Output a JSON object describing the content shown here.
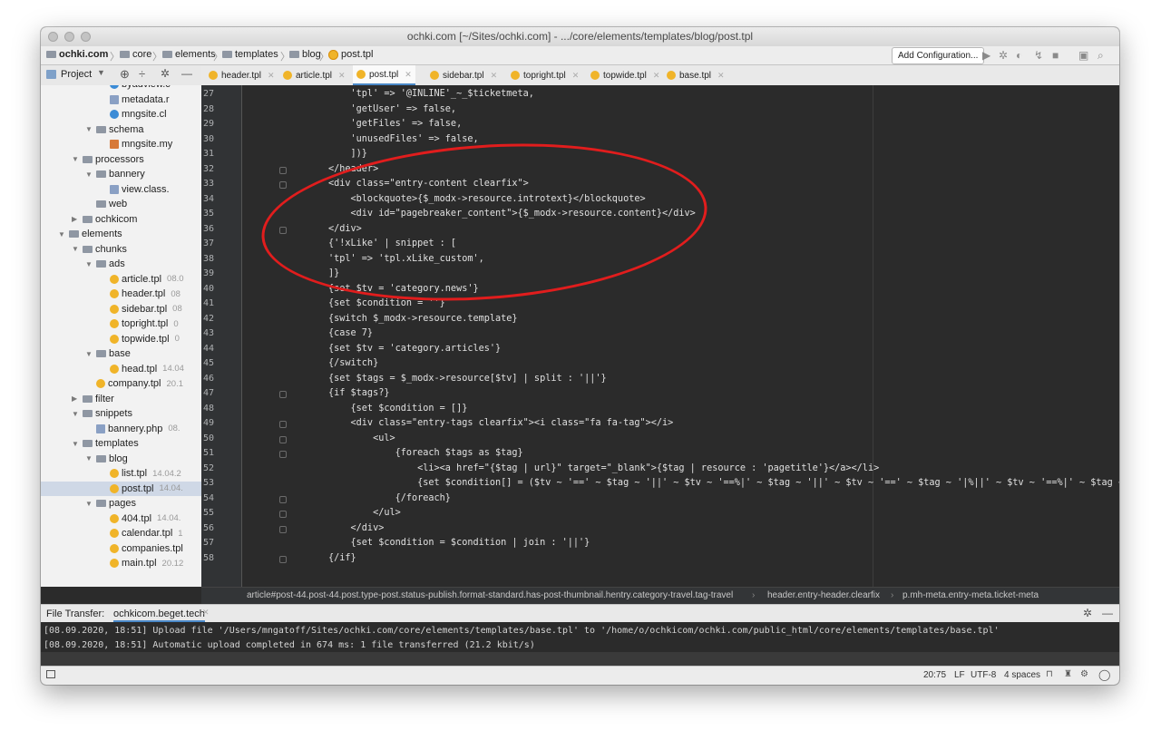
{
  "window": {
    "title": "ochki.com [~/Sites/ochki.com] - .../core/elements/templates/blog/post.tpl"
  },
  "navbar": {
    "crumbs": [
      "ochki.com",
      "core",
      "elements",
      "templates",
      "blog",
      "post.tpl"
    ],
    "add_configuration": "Add Configuration..."
  },
  "sidebar": {
    "title": "Project",
    "rows": [
      {
        "label": "byadview.c",
        "icon": "class-icon",
        "meta": ""
      },
      {
        "label": "metadata.r",
        "icon": "php-icon",
        "meta": ""
      },
      {
        "label": "mngsite.cl",
        "icon": "class-icon",
        "meta": ""
      },
      {
        "label": "schema",
        "icon": "folder-icon",
        "meta": ""
      },
      {
        "label": "mngsite.my",
        "icon": "sql-icon",
        "meta": ""
      },
      {
        "label": "processors",
        "icon": "folder-icon",
        "meta": ""
      },
      {
        "label": "bannery",
        "icon": "folder-icon",
        "meta": ""
      },
      {
        "label": "view.class.",
        "icon": "php-icon",
        "meta": ""
      },
      {
        "label": "web",
        "icon": "folder-icon",
        "meta": ""
      },
      {
        "label": "ochkicom",
        "icon": "folder-icon",
        "meta": ""
      },
      {
        "label": "elements",
        "icon": "folder-icon",
        "meta": ""
      },
      {
        "label": "chunks",
        "icon": "folder-icon",
        "meta": ""
      },
      {
        "label": "ads",
        "icon": "folder-icon",
        "meta": ""
      },
      {
        "label": "article.tpl",
        "icon": "tpl-icon",
        "meta": "08.0"
      },
      {
        "label": "header.tpl",
        "icon": "tpl-icon",
        "meta": "08"
      },
      {
        "label": "sidebar.tpl",
        "icon": "tpl-icon",
        "meta": "08"
      },
      {
        "label": "topright.tpl",
        "icon": "tpl-icon",
        "meta": "0"
      },
      {
        "label": "topwide.tpl",
        "icon": "tpl-icon",
        "meta": "0"
      },
      {
        "label": "base",
        "icon": "folder-icon",
        "meta": ""
      },
      {
        "label": "head.tpl",
        "icon": "tpl-icon",
        "meta": "14.04"
      },
      {
        "label": "company.tpl",
        "icon": "tpl-icon",
        "meta": "20.1"
      },
      {
        "label": "filter",
        "icon": "folder-icon",
        "meta": ""
      },
      {
        "label": "snippets",
        "icon": "folder-icon",
        "meta": ""
      },
      {
        "label": "bannery.php",
        "icon": "php-icon",
        "meta": "08."
      },
      {
        "label": "templates",
        "icon": "folder-icon",
        "meta": ""
      },
      {
        "label": "blog",
        "icon": "folder-icon",
        "meta": ""
      },
      {
        "label": "list.tpl",
        "icon": "tpl-icon",
        "meta": "14.04.2"
      },
      {
        "label": "post.tpl",
        "icon": "tpl-icon",
        "meta": "14.04."
      },
      {
        "label": "pages",
        "icon": "folder-icon",
        "meta": ""
      },
      {
        "label": "404.tpl",
        "icon": "tpl-icon",
        "meta": "14.04."
      },
      {
        "label": "calendar.tpl",
        "icon": "tpl-icon",
        "meta": "1"
      },
      {
        "label": "companies.tpl",
        "icon": "tpl-icon",
        "meta": ""
      },
      {
        "label": "main.tpl",
        "icon": "tpl-icon",
        "meta": "20.12"
      }
    ]
  },
  "tabs": [
    {
      "label": "header.tpl",
      "active": false
    },
    {
      "label": "article.tpl",
      "active": false
    },
    {
      "label": "post.tpl",
      "active": true
    },
    {
      "label": "sidebar.tpl",
      "active": false
    },
    {
      "label": "topright.tpl",
      "active": false
    },
    {
      "label": "topwide.tpl",
      "active": false
    },
    {
      "label": "base.tpl",
      "active": false
    }
  ],
  "editor": {
    "lines": [
      {
        "n": "27",
        "text": "    'tpl' => '@INLINE'_~_$ticketmeta,"
      },
      {
        "n": "28",
        "text": "    'getUser' => false,"
      },
      {
        "n": "29",
        "text": "    'getFiles' => false,"
      },
      {
        "n": "30",
        "text": "    'unusedFiles' => false,"
      },
      {
        "n": "31",
        "text": "    ])}"
      },
      {
        "n": "32",
        "text": "</header>"
      },
      {
        "n": "33",
        "text": "<div class=\"entry-content clearfix\">"
      },
      {
        "n": "34",
        "text": "    <blockquote>{$_modx->resource.introtext}</blockquote>"
      },
      {
        "n": "35",
        "text": "    <div id=\"pagebreaker_content\">{$_modx->resource.content}</div>"
      },
      {
        "n": "36",
        "text": "</div>"
      },
      {
        "n": "37",
        "text": "{'!xLike' | snippet : ["
      },
      {
        "n": "38",
        "text": "'tpl' => 'tpl.xLike_custom',"
      },
      {
        "n": "39",
        "text": "]}"
      },
      {
        "n": "40",
        "text": "{set $tv = 'category.news'}"
      },
      {
        "n": "41",
        "text": "{set $condition = ''}"
      },
      {
        "n": "42",
        "text": "{switch $_modx->resource.template}"
      },
      {
        "n": "43",
        "text": "{case 7}"
      },
      {
        "n": "44",
        "text": "{set $tv = 'category.articles'}"
      },
      {
        "n": "45",
        "text": "{/switch}"
      },
      {
        "n": "46",
        "text": "{set $tags = $_modx->resource[$tv] | split : '||'}"
      },
      {
        "n": "47",
        "text": "{if $tags?}"
      },
      {
        "n": "48",
        "text": "    {set $condition = []}"
      },
      {
        "n": "49",
        "text": "    <div class=\"entry-tags clearfix\"><i class=\"fa fa-tag\"></i>"
      },
      {
        "n": "50",
        "text": "        <ul>"
      },
      {
        "n": "51",
        "text": "            {foreach $tags as $tag}"
      },
      {
        "n": "52",
        "text": "                <li><a href=\"{$tag | url}\" target=\"_blank\">{$tag | resource : 'pagetitle'}</a></li>"
      },
      {
        "n": "53",
        "text": "                {set $condition[] = ($tv ~ '==' ~ $tag ~ '||' ~ $tv ~ '==%|' ~ $tag ~ '||' ~ $tv ~ '==' ~ $tag ~ '|%||' ~ $tv ~ '==%|' ~ $tag ~ '|%')}"
      },
      {
        "n": "54",
        "text": "            {/foreach}"
      },
      {
        "n": "55",
        "text": "        </ul>"
      },
      {
        "n": "56",
        "text": "    </div>"
      },
      {
        "n": "57",
        "text": "    {set $condition = $condition | join : '||'}"
      },
      {
        "n": "58",
        "text": "{/if}"
      }
    ]
  },
  "breadcrumb": {
    "part1": "article#post-44.post-44.post.type-post.status-publish.format-standard.has-post-thumbnail.hentry.category-travel.tag-travel",
    "part2": "header.entry-header.clearfix",
    "part3": "p.mh-meta.entry-meta.ticket-meta"
  },
  "file_transfer": {
    "label": "File Transfer:",
    "tab": "ochkicom.beget.tech",
    "log": [
      "[08.09.2020, 18:51] Upload file '/Users/mngatoff/Sites/ochki.com/core/elements/templates/base.tpl' to '/home/o/ochkicom/ochki.com/public_html/core/elements/templates/base.tpl'",
      "[08.09.2020, 18:51] Automatic upload completed in 674 ms: 1 file transferred (21.2 kbit/s)"
    ]
  },
  "status": {
    "position": "20:75",
    "line_sep": "LF",
    "encoding": "UTF-8",
    "indent": "4 spaces"
  }
}
